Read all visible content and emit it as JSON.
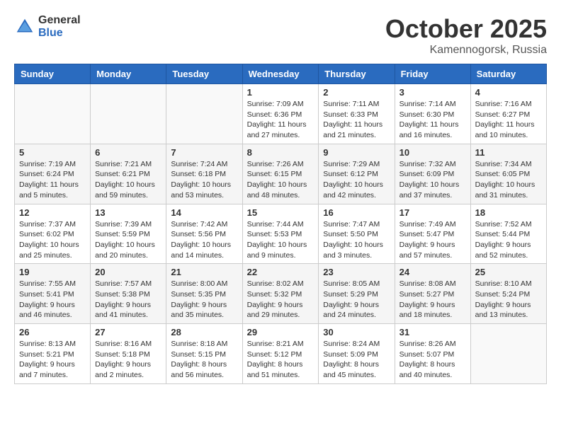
{
  "logo": {
    "general": "General",
    "blue": "Blue"
  },
  "title": "October 2025",
  "location": "Kamennogorsk, Russia",
  "weekdays": [
    "Sunday",
    "Monday",
    "Tuesday",
    "Wednesday",
    "Thursday",
    "Friday",
    "Saturday"
  ],
  "weeks": [
    [
      {
        "day": "",
        "info": ""
      },
      {
        "day": "",
        "info": ""
      },
      {
        "day": "",
        "info": ""
      },
      {
        "day": "1",
        "info": "Sunrise: 7:09 AM\nSunset: 6:36 PM\nDaylight: 11 hours\nand 27 minutes."
      },
      {
        "day": "2",
        "info": "Sunrise: 7:11 AM\nSunset: 6:33 PM\nDaylight: 11 hours\nand 21 minutes."
      },
      {
        "day": "3",
        "info": "Sunrise: 7:14 AM\nSunset: 6:30 PM\nDaylight: 11 hours\nand 16 minutes."
      },
      {
        "day": "4",
        "info": "Sunrise: 7:16 AM\nSunset: 6:27 PM\nDaylight: 11 hours\nand 10 minutes."
      }
    ],
    [
      {
        "day": "5",
        "info": "Sunrise: 7:19 AM\nSunset: 6:24 PM\nDaylight: 11 hours\nand 5 minutes."
      },
      {
        "day": "6",
        "info": "Sunrise: 7:21 AM\nSunset: 6:21 PM\nDaylight: 10 hours\nand 59 minutes."
      },
      {
        "day": "7",
        "info": "Sunrise: 7:24 AM\nSunset: 6:18 PM\nDaylight: 10 hours\nand 53 minutes."
      },
      {
        "day": "8",
        "info": "Sunrise: 7:26 AM\nSunset: 6:15 PM\nDaylight: 10 hours\nand 48 minutes."
      },
      {
        "day": "9",
        "info": "Sunrise: 7:29 AM\nSunset: 6:12 PM\nDaylight: 10 hours\nand 42 minutes."
      },
      {
        "day": "10",
        "info": "Sunrise: 7:32 AM\nSunset: 6:09 PM\nDaylight: 10 hours\nand 37 minutes."
      },
      {
        "day": "11",
        "info": "Sunrise: 7:34 AM\nSunset: 6:05 PM\nDaylight: 10 hours\nand 31 minutes."
      }
    ],
    [
      {
        "day": "12",
        "info": "Sunrise: 7:37 AM\nSunset: 6:02 PM\nDaylight: 10 hours\nand 25 minutes."
      },
      {
        "day": "13",
        "info": "Sunrise: 7:39 AM\nSunset: 5:59 PM\nDaylight: 10 hours\nand 20 minutes."
      },
      {
        "day": "14",
        "info": "Sunrise: 7:42 AM\nSunset: 5:56 PM\nDaylight: 10 hours\nand 14 minutes."
      },
      {
        "day": "15",
        "info": "Sunrise: 7:44 AM\nSunset: 5:53 PM\nDaylight: 10 hours\nand 9 minutes."
      },
      {
        "day": "16",
        "info": "Sunrise: 7:47 AM\nSunset: 5:50 PM\nDaylight: 10 hours\nand 3 minutes."
      },
      {
        "day": "17",
        "info": "Sunrise: 7:49 AM\nSunset: 5:47 PM\nDaylight: 9 hours\nand 57 minutes."
      },
      {
        "day": "18",
        "info": "Sunrise: 7:52 AM\nSunset: 5:44 PM\nDaylight: 9 hours\nand 52 minutes."
      }
    ],
    [
      {
        "day": "19",
        "info": "Sunrise: 7:55 AM\nSunset: 5:41 PM\nDaylight: 9 hours\nand 46 minutes."
      },
      {
        "day": "20",
        "info": "Sunrise: 7:57 AM\nSunset: 5:38 PM\nDaylight: 9 hours\nand 41 minutes."
      },
      {
        "day": "21",
        "info": "Sunrise: 8:00 AM\nSunset: 5:35 PM\nDaylight: 9 hours\nand 35 minutes."
      },
      {
        "day": "22",
        "info": "Sunrise: 8:02 AM\nSunset: 5:32 PM\nDaylight: 9 hours\nand 29 minutes."
      },
      {
        "day": "23",
        "info": "Sunrise: 8:05 AM\nSunset: 5:29 PM\nDaylight: 9 hours\nand 24 minutes."
      },
      {
        "day": "24",
        "info": "Sunrise: 8:08 AM\nSunset: 5:27 PM\nDaylight: 9 hours\nand 18 minutes."
      },
      {
        "day": "25",
        "info": "Sunrise: 8:10 AM\nSunset: 5:24 PM\nDaylight: 9 hours\nand 13 minutes."
      }
    ],
    [
      {
        "day": "26",
        "info": "Sunrise: 8:13 AM\nSunset: 5:21 PM\nDaylight: 9 hours\nand 7 minutes."
      },
      {
        "day": "27",
        "info": "Sunrise: 8:16 AM\nSunset: 5:18 PM\nDaylight: 9 hours\nand 2 minutes."
      },
      {
        "day": "28",
        "info": "Sunrise: 8:18 AM\nSunset: 5:15 PM\nDaylight: 8 hours\nand 56 minutes."
      },
      {
        "day": "29",
        "info": "Sunrise: 8:21 AM\nSunset: 5:12 PM\nDaylight: 8 hours\nand 51 minutes."
      },
      {
        "day": "30",
        "info": "Sunrise: 8:24 AM\nSunset: 5:09 PM\nDaylight: 8 hours\nand 45 minutes."
      },
      {
        "day": "31",
        "info": "Sunrise: 8:26 AM\nSunset: 5:07 PM\nDaylight: 8 hours\nand 40 minutes."
      },
      {
        "day": "",
        "info": ""
      }
    ]
  ]
}
